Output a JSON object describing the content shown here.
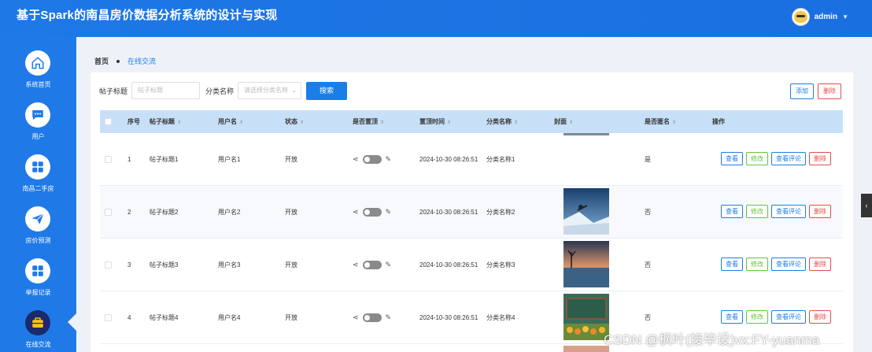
{
  "app": {
    "title": "基于Spark的南昌房价数据分析系统的设计与实现",
    "user": "admin"
  },
  "sidebar": [
    {
      "label": "系统首页",
      "icon": "home-icon"
    },
    {
      "label": "用户",
      "icon": "chat-icon"
    },
    {
      "label": "南昌二手房",
      "icon": "grid-icon"
    },
    {
      "label": "房价预测",
      "icon": "send-icon"
    },
    {
      "label": "举报记录",
      "icon": "grid-icon"
    },
    {
      "label": "在线交流",
      "icon": "briefcase-icon",
      "active": true
    }
  ],
  "breadcrumb": {
    "home": "首页",
    "current": "在线交流"
  },
  "filters": {
    "title_label": "帖子标题",
    "title_placeholder": "帖子标题",
    "category_label": "分类名称",
    "category_placeholder": "请选择分类名称",
    "search": "搜索"
  },
  "actions": {
    "add": "添加",
    "delete": "删除"
  },
  "columns": [
    "序号",
    "帖子标题",
    "用户名",
    "状态",
    "是否置顶",
    "置顶时间",
    "分类名称",
    "封面",
    "是否匿名",
    "操作"
  ],
  "rows": [
    {
      "no": "1",
      "title": "帖子标题1",
      "user": "用户名1",
      "status": "开放",
      "time": "2024-10-30 08:26:51",
      "category": "分类名称1",
      "anon": "是",
      "cover": ""
    },
    {
      "no": "2",
      "title": "帖子标题2",
      "user": "用户名2",
      "status": "开放",
      "time": "2024-10-30 08:26:51",
      "category": "分类名称2",
      "anon": "否",
      "cover": "ski"
    },
    {
      "no": "3",
      "title": "帖子标题3",
      "user": "用户名3",
      "status": "开放",
      "time": "2024-10-30 08:26:51",
      "category": "分类名称3",
      "anon": "否",
      "cover": "lake"
    },
    {
      "no": "4",
      "title": "帖子标题4",
      "user": "用户名4",
      "status": "开放",
      "time": "2024-10-30 08:26:51",
      "category": "分类名称4",
      "anon": "否",
      "cover": "flowers"
    }
  ],
  "row_ops": {
    "view": "查看",
    "edit": "修改",
    "comments": "查看评论",
    "delete": "删除"
  },
  "watermark": "CSDN @枫叶(接毕设)vx:FY-yuanma"
}
